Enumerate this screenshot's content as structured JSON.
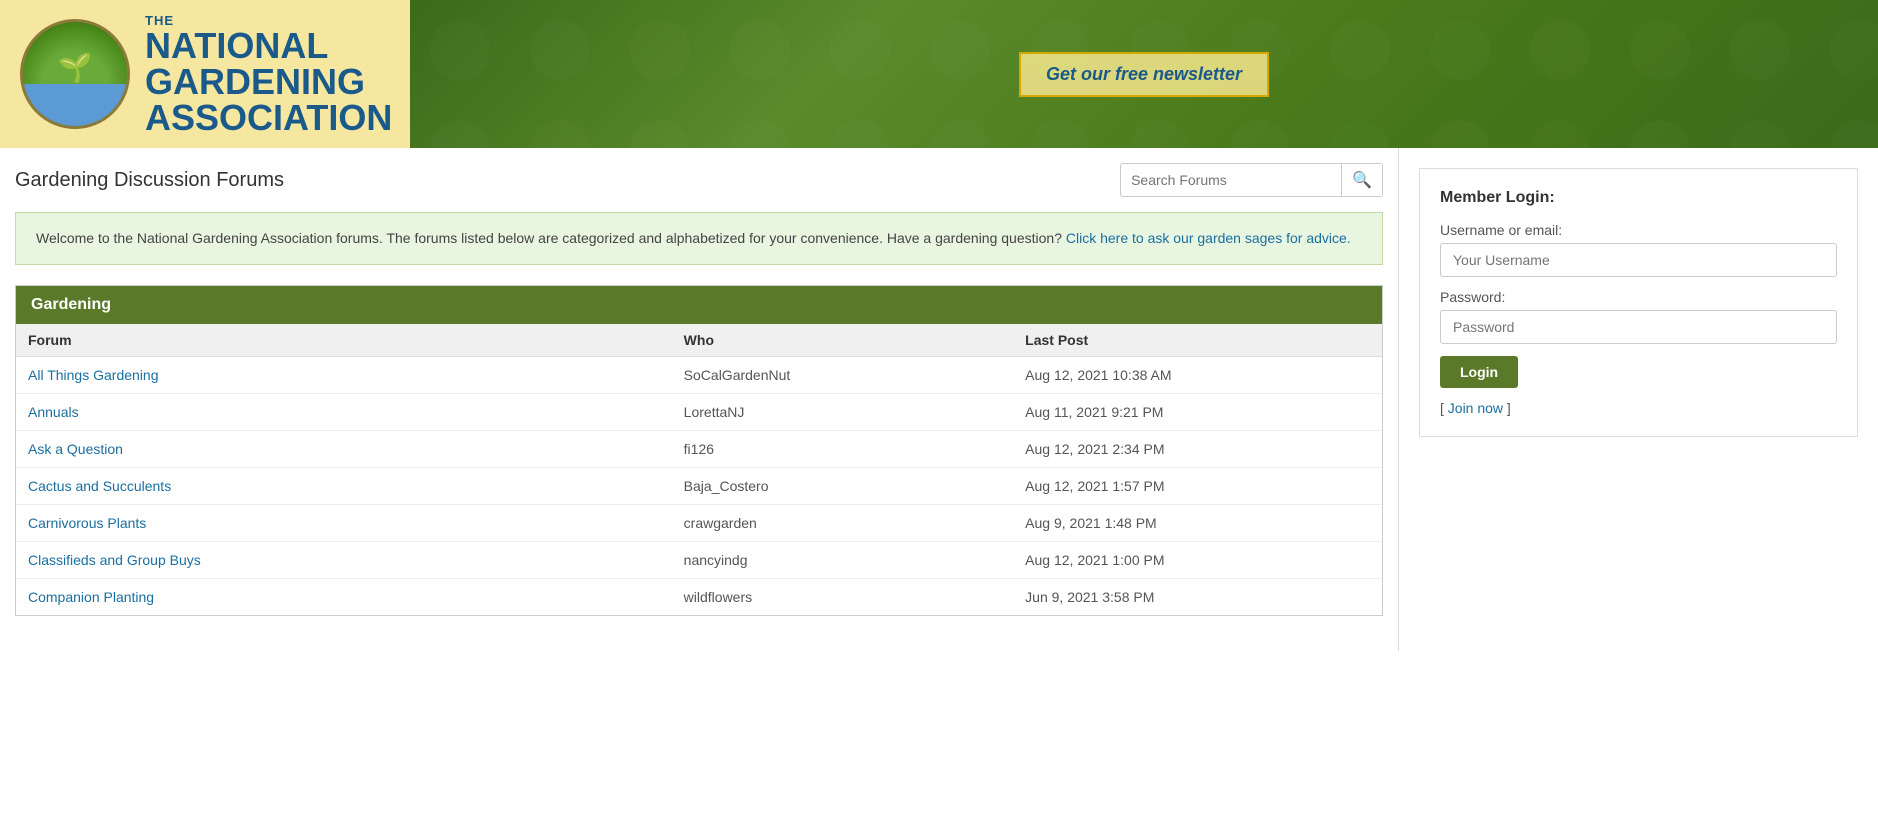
{
  "header": {
    "logo": {
      "org_name_top": "THE NATIONAL GARDENING",
      "org_name_bottom": "ASSOCIATION",
      "title_line1": "THE",
      "title_line2": "NATIONAL",
      "title_line3": "GARDENING",
      "title_line4": "ASSOCIATION"
    },
    "newsletter_btn": "Get our free newsletter"
  },
  "page": {
    "title": "Gardening Discussion Forums",
    "search_placeholder": "Search Forums"
  },
  "welcome": {
    "text1": "Welcome to the National Gardening Association forums. The forums listed below are categorized and alphabetized for your convenience. Have a gardening question?",
    "link_text": "Click here to ask our garden sages for advice.",
    "link_href": "#"
  },
  "gardening_section": {
    "header": "Gardening",
    "columns": [
      "Forum",
      "Who",
      "Last Post"
    ],
    "rows": [
      {
        "forum": "All Things Gardening",
        "who": "SoCalGardenNut",
        "last_post": "Aug 12, 2021 10:38 AM"
      },
      {
        "forum": "Annuals",
        "who": "LorettaNJ",
        "last_post": "Aug 11, 2021 9:21 PM"
      },
      {
        "forum": "Ask a Question",
        "who": "fi126",
        "last_post": "Aug 12, 2021 2:34 PM"
      },
      {
        "forum": "Cactus and Succulents",
        "who": "Baja_Costero",
        "last_post": "Aug 12, 2021 1:57 PM"
      },
      {
        "forum": "Carnivorous Plants",
        "who": "crawgarden",
        "last_post": "Aug 9, 2021 1:48 PM"
      },
      {
        "forum": "Classifieds and Group Buys",
        "who": "nancyindg",
        "last_post": "Aug 12, 2021 1:00 PM"
      },
      {
        "forum": "Companion Planting",
        "who": "wildflowers",
        "last_post": "Jun 9, 2021 3:58 PM"
      }
    ]
  },
  "sidebar": {
    "login": {
      "title": "Member Login:",
      "username_label": "Username or email:",
      "username_placeholder": "Your Username",
      "password_label": "Password:",
      "password_placeholder": "Password",
      "login_btn": "Login",
      "join_prefix": "[ ",
      "join_link": "Join now",
      "join_suffix": " ]"
    }
  }
}
